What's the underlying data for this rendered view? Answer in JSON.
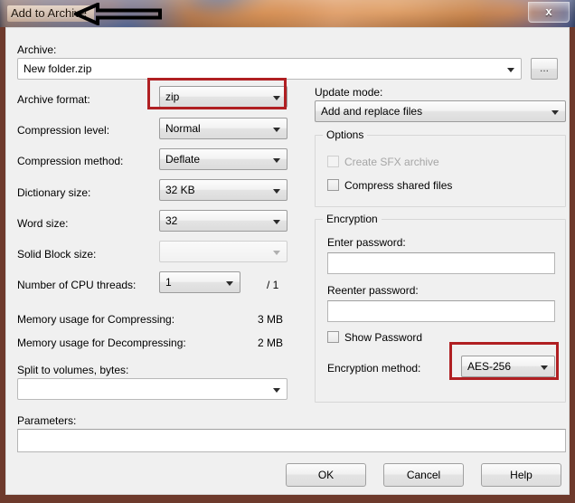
{
  "window": {
    "title": "Add to Archive",
    "close_label": "x",
    "frame_color": "#6e3a2c",
    "annotation_color": "#b01f22"
  },
  "archive": {
    "label": "Archive:",
    "value": "New folder.zip",
    "browse_label": "..."
  },
  "left": {
    "archive_format": {
      "label": "Archive format:",
      "value": "zip"
    },
    "compression_level": {
      "label": "Compression level:",
      "value": "Normal"
    },
    "compression_method": {
      "label": "Compression method:",
      "value": "Deflate"
    },
    "dictionary_size": {
      "label": "Dictionary size:",
      "value": "32 KB"
    },
    "word_size": {
      "label": "Word size:",
      "value": "32"
    },
    "solid_block_size": {
      "label": "Solid Block size:",
      "value": ""
    },
    "cpu_threads": {
      "label": "Number of CPU threads:",
      "value": "1",
      "total": "/ 1"
    },
    "mem_compress": {
      "label": "Memory usage for Compressing:",
      "value": "3 MB"
    },
    "mem_decompress": {
      "label": "Memory usage for Decompressing:",
      "value": "2 MB"
    },
    "split_volumes": {
      "label": "Split to volumes, bytes:",
      "value": ""
    }
  },
  "right": {
    "update_mode": {
      "label": "Update mode:",
      "value": "Add and replace files"
    },
    "options": {
      "title": "Options",
      "create_sfx": {
        "label": "Create SFX archive",
        "checked": false,
        "disabled": true
      },
      "compress_shared": {
        "label": "Compress shared files",
        "checked": false,
        "disabled": false
      }
    },
    "encryption": {
      "title": "Encryption",
      "enter_password": {
        "label": "Enter password:",
        "value": ""
      },
      "reenter_password": {
        "label": "Reenter password:",
        "value": ""
      },
      "show_password": {
        "label": "Show Password",
        "checked": false
      },
      "method": {
        "label": "Encryption method:",
        "value": "AES-256"
      }
    }
  },
  "parameters": {
    "label": "Parameters:",
    "value": ""
  },
  "buttons": {
    "ok": "OK",
    "cancel": "Cancel",
    "help": "Help"
  }
}
